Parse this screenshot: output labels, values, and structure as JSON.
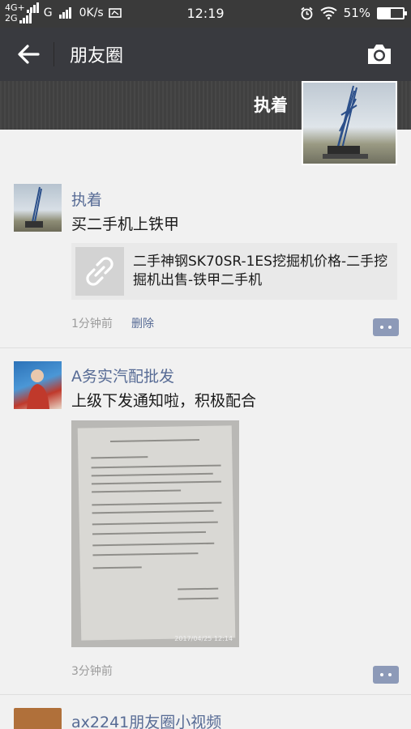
{
  "status": {
    "net_top": "4G+",
    "net_bottom": "2G",
    "net_type": "G",
    "speed": "0K/s",
    "time": "12:19",
    "battery_text": "51%",
    "battery_level": 0.51
  },
  "nav": {
    "title": "朋友圈",
    "back_icon": "back-arrow-icon",
    "camera_icon": "camera-icon"
  },
  "cover": {
    "name": "执着"
  },
  "posts": [
    {
      "name": "执着",
      "text": "买二手机上铁甲",
      "link_title": "二手神钢SK70SR-1ES挖掘机价格-二手挖掘机出售-铁甲二手机",
      "link_icon": "link-icon",
      "time_ago": "1分钟前",
      "delete_label": "删除"
    },
    {
      "name": "A务实汽配批发",
      "text": "上级下发通知啦，积极配合",
      "time_ago": "3分钟前",
      "photo_timestamp": "2017/04/25 12:14"
    },
    {
      "name": "ax2241朋友圈小视频"
    }
  ],
  "colors": {
    "nav_bg": "#393a3f",
    "link_blue": "#576b95"
  }
}
